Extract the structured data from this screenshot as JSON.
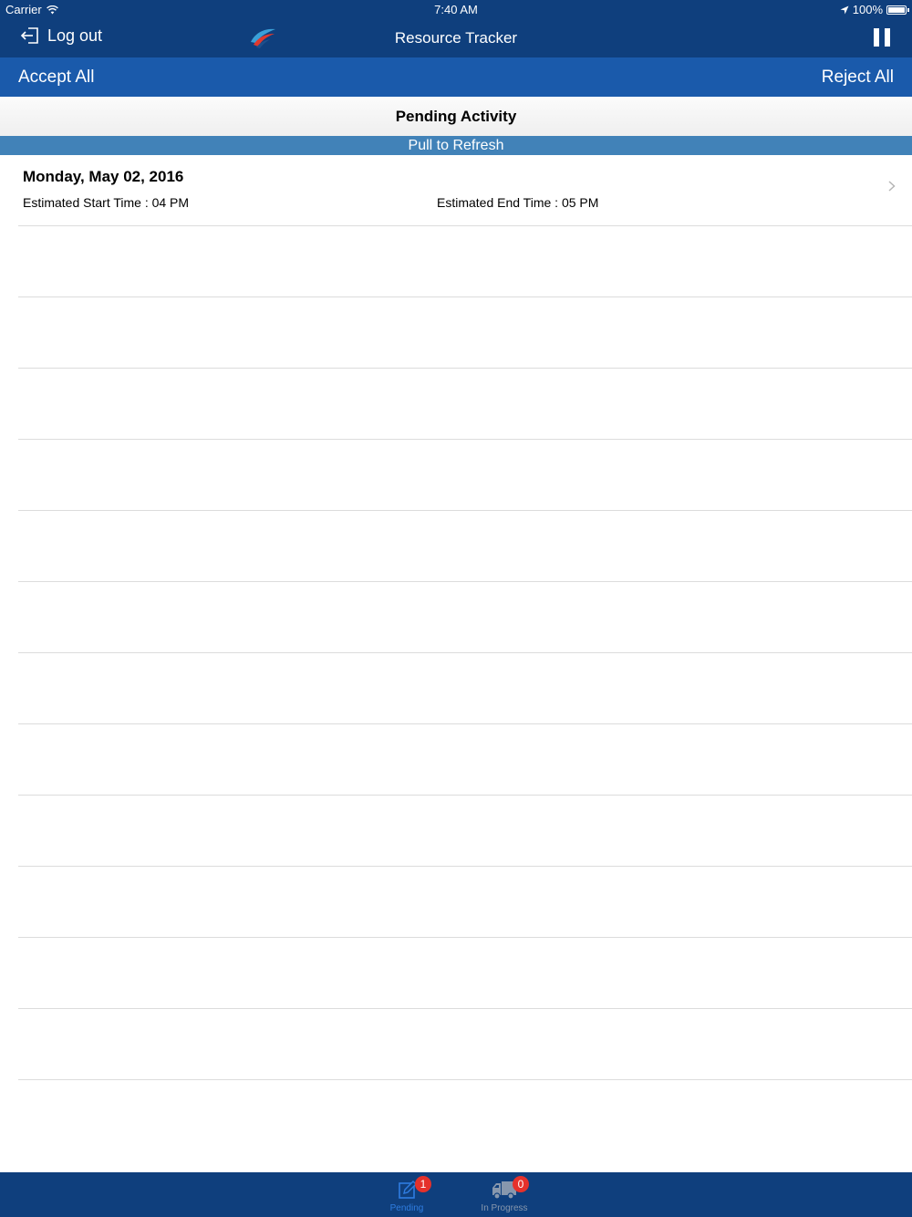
{
  "status_bar": {
    "carrier": "Carrier",
    "time": "7:40 AM",
    "battery": "100%"
  },
  "nav": {
    "logout_label": "Log out",
    "title": "Resource Tracker"
  },
  "actions": {
    "accept_all": "Accept All",
    "reject_all": "Reject All"
  },
  "section": {
    "title": "Pending Activity",
    "refresh": "Pull to Refresh"
  },
  "activities": [
    {
      "date": "Monday, May 02, 2016",
      "start": "Estimated Start Time :  04 PM",
      "end": "Estimated End Time :  05 PM"
    }
  ],
  "tabs": [
    {
      "label": "Pending",
      "badge": "1",
      "icon": "edit-icon",
      "active": true
    },
    {
      "label": "In Progress",
      "badge": "0",
      "icon": "truck-icon",
      "active": false
    }
  ],
  "colors": {
    "nav_bg": "#0f3f7d",
    "action_bg": "#1a5aab",
    "refresh_bg": "#4182b8",
    "badge": "#e5312b",
    "active_tab": "#2f7de1"
  }
}
